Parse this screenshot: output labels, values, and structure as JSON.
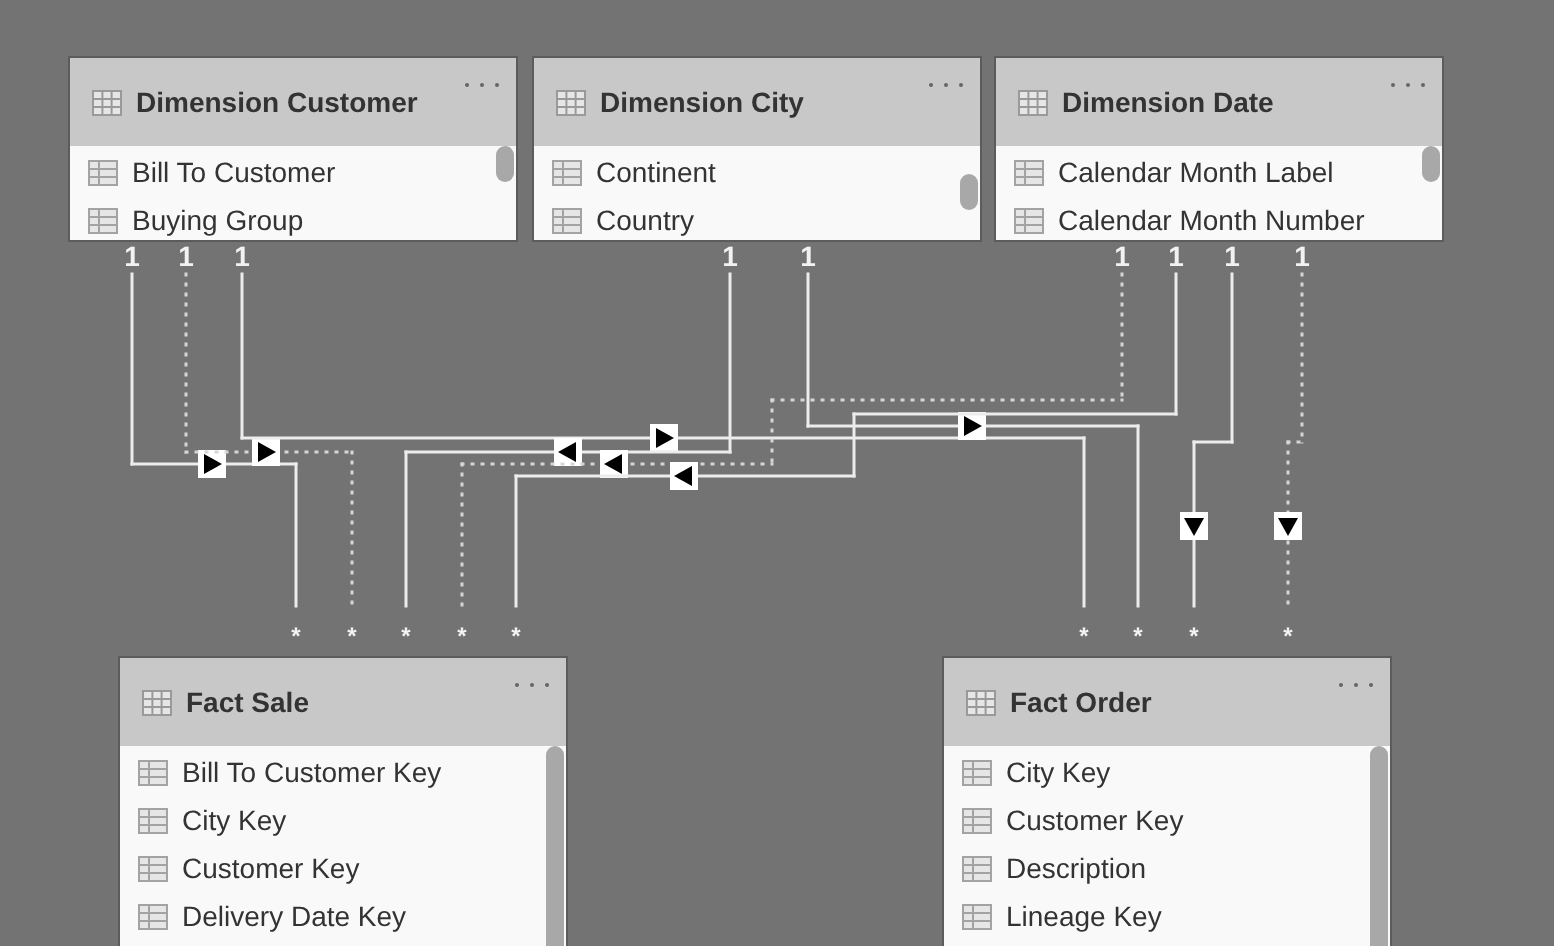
{
  "tables": [
    {
      "title": "Dimension Customer",
      "columns": [
        "Bill To Customer",
        "Buying Group"
      ]
    },
    {
      "title": "Dimension City",
      "columns": [
        "Continent",
        "Country"
      ]
    },
    {
      "title": "Dimension Date",
      "columns": [
        "Calendar Month Label",
        "Calendar Month Number"
      ]
    },
    {
      "title": "Fact Sale",
      "columns": [
        "Bill To Customer Key",
        "City Key",
        "Customer Key",
        "Delivery Date Key"
      ]
    },
    {
      "title": "Fact Order",
      "columns": [
        "City Key",
        "Customer Key",
        "Description",
        "Lineage Key"
      ]
    }
  ],
  "one_labels": [
    "1",
    "1",
    "1",
    "1",
    "1",
    "1",
    "1",
    "1",
    "1"
  ],
  "many_labels": [
    "*",
    "*",
    "*",
    "*",
    "*",
    "*",
    "*",
    "*",
    "*"
  ],
  "relationships": [
    {
      "active": true
    },
    {
      "active": false
    },
    {
      "active": true
    },
    {
      "active": true
    },
    {
      "active": true
    },
    {
      "active": false
    },
    {
      "active": true
    },
    {
      "active": true
    },
    {
      "active": false
    }
  ]
}
